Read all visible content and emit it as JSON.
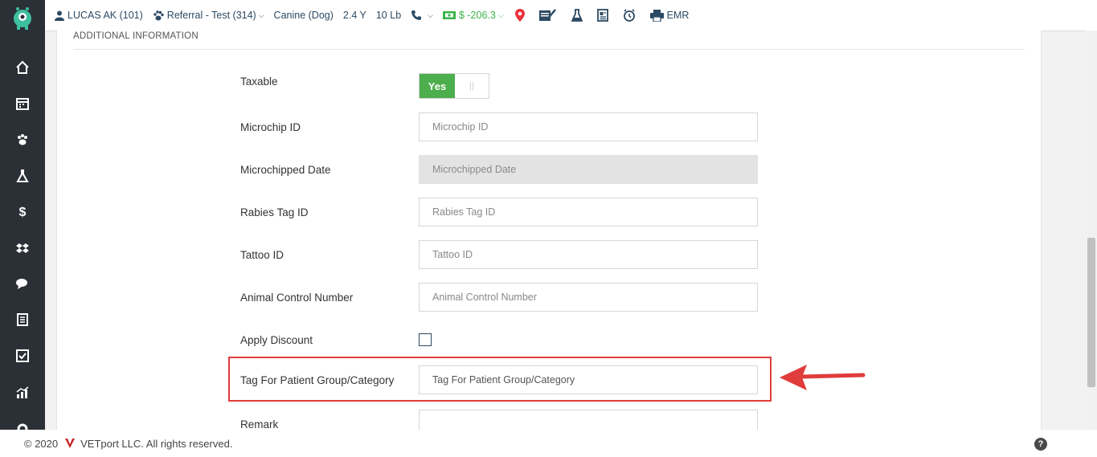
{
  "topbar": {
    "client": "LUCAS AK (101)",
    "patient": "Referral - Test (314)",
    "species": "Canine (Dog)",
    "age": "2.4 Y",
    "weight": "10 Lb",
    "balance": "$ -206.3",
    "emr": "EMR"
  },
  "section": {
    "title": "ADDITIONAL INFORMATION"
  },
  "form": {
    "taxable": {
      "label": "Taxable",
      "toggle_on": "Yes",
      "toggle_off": "||"
    },
    "microchip_id": {
      "label": "Microchip ID",
      "placeholder": "Microchip ID"
    },
    "microchipped_date": {
      "label": "Microchipped Date",
      "placeholder": "Microchipped Date"
    },
    "rabies_tag_id": {
      "label": "Rabies Tag ID",
      "placeholder": "Rabies Tag ID"
    },
    "tattoo_id": {
      "label": "Tattoo ID",
      "placeholder": "Tattoo ID"
    },
    "animal_control_number": {
      "label": "Animal Control Number",
      "placeholder": "Animal Control Number"
    },
    "apply_discount": {
      "label": "Apply Discount"
    },
    "tag_group": {
      "label": "Tag For Patient Group/Category",
      "placeholder": "Tag For Patient Group/Category"
    },
    "remark": {
      "label": "Remark"
    }
  },
  "footer": {
    "copyright": "© 2020",
    "company": "VETport LLC. All rights reserved.",
    "help": "?"
  },
  "colors": {
    "sidebar": "#2a3036",
    "accent_green": "#4cae4c",
    "highlight_red": "#e03c3c",
    "link_blue": "#2c4a63"
  },
  "icons": [
    "monster-logo-icon",
    "home-icon",
    "calendar-icon",
    "paw-icon",
    "flask-icon",
    "dollar-icon",
    "dropbox-icon",
    "chat-icon",
    "document-icon",
    "checkbox-icon",
    "chart-icon",
    "gear-icon",
    "user-icon",
    "paw-icon",
    "phone-icon",
    "money-icon",
    "location-icon",
    "vaccine-icon",
    "lab-icon",
    "notes-icon",
    "clock-icon",
    "print-icon"
  ]
}
